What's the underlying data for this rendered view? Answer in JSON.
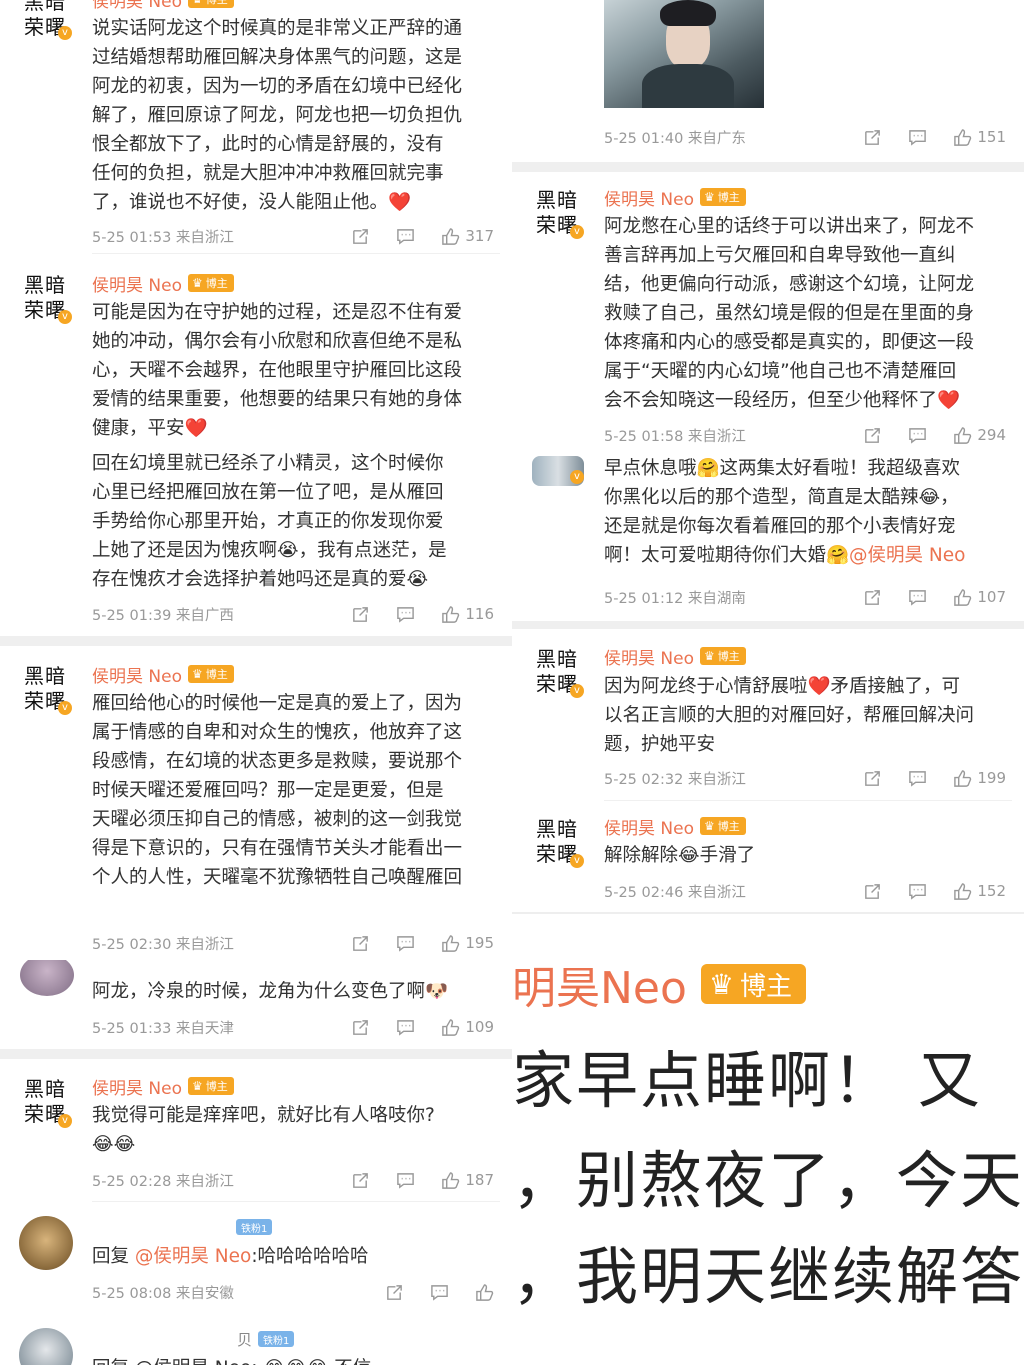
{
  "icons": {
    "share": "share-icon",
    "comment": "comment-icon",
    "like": "like-icon"
  },
  "colors": {
    "name": "#eb7350",
    "badge": "#f6a623",
    "fan": "#7ab3e9",
    "meta": "#999999",
    "text": "#333333"
  },
  "left": [
    {
      "avatar_text": "黑暗\n荣曙",
      "name": "侯明昊 Neo",
      "badge": "博主",
      "text": "说实话阿龙这个时候真的是非常义正严辞的通\n过结婚想帮助雁回解决身体黑气的问题，这是\n阿龙的初衷，因为一切的矛盾在幻境中已经化\n解了，雁回原谅了阿龙，阿龙也把一切负担仇\n恨全都放下了，此时的心情是舒展的，没有\n任何的负担，就是大胆冲冲冲救雁回就完事\n了，谁说也不好使，没人能阻止他。❤️",
      "time": "5-25 01:53 来自浙江",
      "likes": "317"
    },
    {
      "avatar_text": "黑暗\n荣曙",
      "name": "侯明昊 Neo",
      "badge": "博主",
      "text": "可能是因为在守护她的过程，还是忍不住有爱\n她的冲动，偶尔会有小欣慰和欣喜但绝不是私\n心，天曜不会越界，在他眼里守护雁回比这段\n爱情的结果重要，他想要的结果只有她的身体\n健康，平安❤️",
      "quote": "回在幻境里就已经杀了小精灵，这个时候你\n心里已经把雁回放在第一位了吧，是从雁回\n手势给你心那里开始，才真正的你发现你爱\n上她了还是因为愧疚啊😭，我有点迷茫，是\n存在愧疚才会选择护着她吗还是真的爱😭",
      "time": "5-25 01:39 来自广西",
      "likes": "116"
    },
    {
      "avatar_text": "黑暗\n荣曙",
      "name": "侯明昊 Neo",
      "badge": "博主",
      "text": "雁回给他心的时候他一定是真的爱上了，因为\n属于情感的自卑和对众生的愧疚，他放弃了这\n段感情，在幻境的状态更多是救赎，要说那个\n时候天曜还爱雁回吗？那一定是更爱，但是\n天曜必须压抑自己的情感，被刺的这一剑我觉\n得是下意识的，只有在强情节关头才能看出一\n个人的人性，天曜毫不犹豫牺牲自己唤醒雁回",
      "time": "5-25 02:30 来自浙江",
      "likes": "195"
    },
    {
      "text": "阿龙，冷泉的时候，龙角为什么变色了啊🐶",
      "time": "5-25 01:33 来自天津",
      "likes": "109"
    },
    {
      "avatar_text": "黑暗\n荣曙",
      "name": "侯明昊 Neo",
      "badge": "博主",
      "text": "我觉得可能是痒痒吧，就好比有人咯吱你?\n😂😂",
      "time": "5-25 02:28 来自浙江",
      "likes": "187"
    },
    {
      "fan_badge": "铁粉1",
      "reply_prefix": "回复 ",
      "mention": "@侯明昊 Neo",
      "reply_text": ":哈哈哈哈哈哈",
      "time": "5-25 08:08 来自安徽"
    },
    {
      "name": "贝",
      "fan_badge": "铁粉1",
      "text": "回复 @侯明昊 Neo: 😂😂😂 不信"
    }
  ],
  "right": [
    {
      "time": "5-25 01:40 来自广东",
      "likes": "151"
    },
    {
      "avatar_text": "黑暗\n荣曙",
      "name": "侯明昊 Neo",
      "badge": "博主",
      "text": "阿龙憋在心里的话终于可以讲出来了，阿龙不\n善言辞再加上亏欠雁回和自卑导致他一直纠\n结，他更偏向行动派，感谢这个幻境，让阿龙\n救赎了自己，虽然幻境是假的但是在里面的身\n体疼痛和内心的感受都是真实的，即便这一段\n属于“天曜的内心幻境”他自己也不清楚雁回\n会不会知晓这一段经历，但至少他释怀了❤️",
      "time": "5-25 01:58 来自浙江",
      "likes": "294"
    },
    {
      "text": "早点休息哦🤗这两集太好看啦！我超级喜欢\n你黑化以后的那个造型，简直是太酷辣😂，\n还是就是你每次看着雁回的那个小表情好宠\n啊！太可爱啦期待你们大婚🤗",
      "mention": "@侯明昊 Neo",
      "time": "5-25 01:12 来自湖南",
      "likes": "107"
    },
    {
      "avatar_text": "黑暗\n荣曙",
      "name": "侯明昊 Neo",
      "badge": "博主",
      "text": "因为阿龙终于心情舒展啦❤️矛盾接触了，可\n以名正言顺的大胆的对雁回好，帮雁回解决问\n题，护她平安",
      "time": "5-25 02:32 来自浙江",
      "likes": "199"
    },
    {
      "avatar_text": "黑暗\n荣曙",
      "name": "侯明昊 Neo",
      "badge": "博主",
      "text": "解除解除😂手滑了",
      "time": "5-25 02:46 来自浙江",
      "likes": "152"
    }
  ],
  "zoom": {
    "name": "明昊Neo",
    "badge": "博主",
    "line1": "家早点睡啊！ 又",
    "line2": "，别熬夜了，今天",
    "line3": "，我明天继续解答"
  }
}
